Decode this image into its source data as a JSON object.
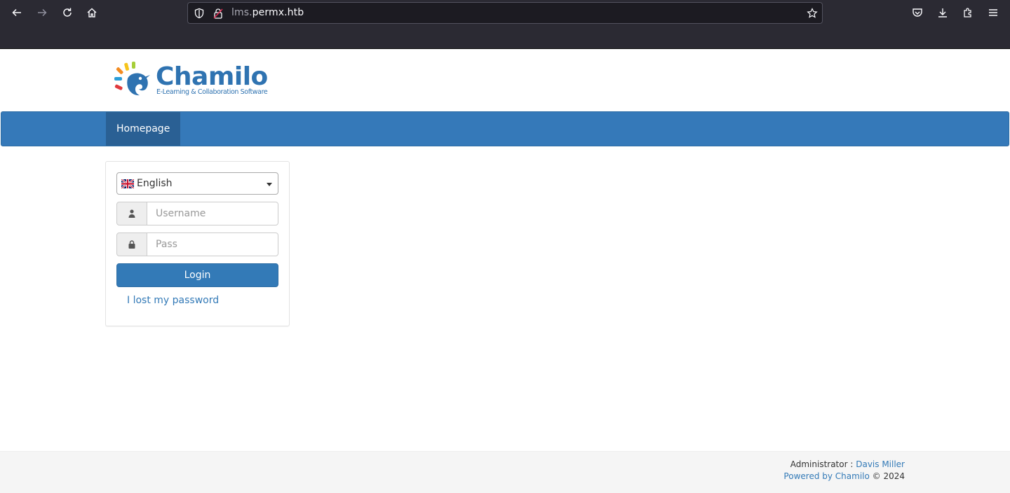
{
  "browser": {
    "url_subdomain": "lms.",
    "url_domain": "permx.htb"
  },
  "logo": {
    "wordmark": "Chamilo",
    "tagline": "E-Learning & Collaboration Software"
  },
  "navbar": {
    "items": [
      {
        "label": "Homepage",
        "active": true
      }
    ]
  },
  "login": {
    "language": "English",
    "username_placeholder": "Username",
    "password_placeholder": "Pass",
    "login_label": "Login",
    "lost_password_label": "I lost my password"
  },
  "footer": {
    "admin_prefix": "Administrator : ",
    "admin_name": "Davis Miller",
    "powered_by": "Powered by Chamilo",
    "copyright": " © 2024"
  },
  "colors": {
    "navbar": "#3579b9",
    "navbar_active": "#2a6094",
    "link": "#337ab7",
    "primary_button": "#337ab7"
  }
}
